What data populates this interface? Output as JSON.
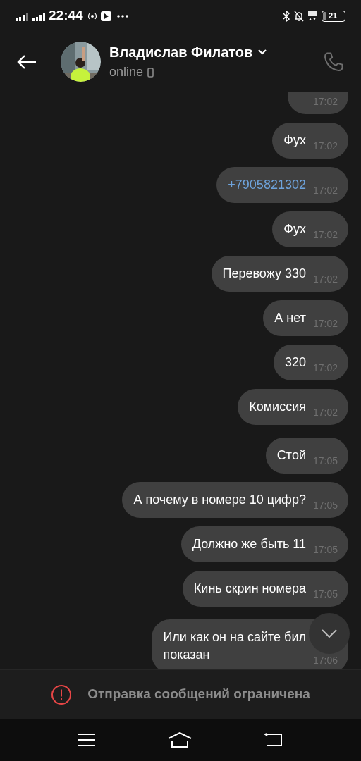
{
  "status_bar": {
    "time": "22:44",
    "battery": "21"
  },
  "header": {
    "name": "Владислав Филатов",
    "presence": "online"
  },
  "messages": [
    {
      "time": "17:02",
      "kind": "clipped"
    },
    {
      "text": "Фух",
      "time": "17:02",
      "kind": "text"
    },
    {
      "text": "+7905821302",
      "time": "17:02",
      "kind": "phone"
    },
    {
      "text": "Фух",
      "time": "17:02",
      "kind": "text"
    },
    {
      "text": "Перевожу 330",
      "time": "17:02",
      "kind": "text"
    },
    {
      "text": "А нет",
      "time": "17:02",
      "kind": "text"
    },
    {
      "text": "320",
      "time": "17:02",
      "kind": "text"
    },
    {
      "text": "Комиссия",
      "time": "17:02",
      "kind": "text"
    },
    {
      "text": "Стой",
      "time": "17:05",
      "kind": "text"
    },
    {
      "text": "А почему в номере 10 цифр?",
      "time": "17:05",
      "kind": "text"
    },
    {
      "text": "Должно же быть 11",
      "time": "17:05",
      "kind": "text"
    },
    {
      "text": "Кинь скрин номера",
      "time": "17:05",
      "kind": "text"
    },
    {
      "text": "Или как он на сайте бил\nпоказан",
      "time": "17:06",
      "kind": "text"
    }
  ],
  "restriction_notice": "Отправка сообщений ограничена"
}
